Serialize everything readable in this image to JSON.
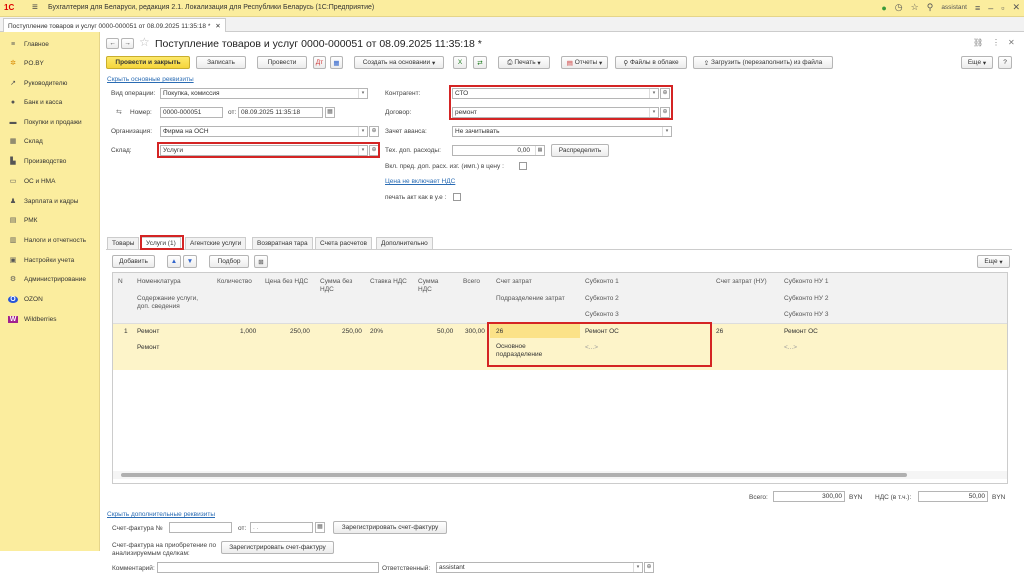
{
  "app": {
    "logo": "1С",
    "title": "Бухгалтерия для Беларуси, редакция 2.1. Локализация для Республики Беларусь (1С:Предприятие)",
    "user": "assistant",
    "tab_title": "Поступление товаров и услуг 0000-000051 от 08.09.2025 11:35:18 *"
  },
  "sidebar": {
    "items": [
      {
        "label": "Главное",
        "icon": "≡"
      },
      {
        "label": "PO.BY",
        "icon": "✲"
      },
      {
        "label": "Руководителю",
        "icon": "↗"
      },
      {
        "label": "Банк и касса",
        "icon": "●"
      },
      {
        "label": "Покупки и продажи",
        "icon": "▬"
      },
      {
        "label": "Склад",
        "icon": "▦"
      },
      {
        "label": "Производство",
        "icon": "▙"
      },
      {
        "label": "ОС и НМА",
        "icon": "▭"
      },
      {
        "label": "Зарплата и кадры",
        "icon": "♟"
      },
      {
        "label": "РМК",
        "icon": "▤"
      },
      {
        "label": "Налоги и отчетность",
        "icon": "▥"
      },
      {
        "label": "Настройки учета",
        "icon": "▣"
      },
      {
        "label": "Администрирование",
        "icon": "⚙"
      },
      {
        "label": "OZON",
        "icon": "O"
      },
      {
        "label": "Wildberries",
        "icon": "W"
      }
    ]
  },
  "doc": {
    "title": "Поступление товаров и услуг 0000-000051 от 08.09.2025 11:35:18 *"
  },
  "toolbar": {
    "post_close": "Провести и закрыть",
    "save": "Записать",
    "post": "Провести",
    "create_based": "Создать на основании",
    "print": "Печать",
    "reports": "Отчеты",
    "files": "Файлы в облаке",
    "load": "Загрузить (перезаполнить) из файла",
    "more": "Еще",
    "help": "?"
  },
  "header": {
    "hide_link": "Скрыть основные реквизиты",
    "op_label": "Вид операции:",
    "op_value": "Покупка, комиссия",
    "num_label": "Номер:",
    "num_value": "0000-000051",
    "from_label": "от:",
    "date_value": "08.09.2025 11:35:18",
    "org_label": "Организация:",
    "org_value": "Фирма на ОСН",
    "wh_label": "Склад:",
    "wh_value": "Услуги",
    "cp_label": "Контрагент:",
    "cp_value": "СТО",
    "contract_label": "Договор:",
    "contract_value": "ремонт",
    "advance_label": "Зачет аванса:",
    "advance_value": "Не зачитывать",
    "extra_label": "Тех. доп. расходы:",
    "extra_value": "0,00",
    "distribute": "Распределить",
    "vkl_label": "Вкл. пред. доп. расх. изг. (имп.) в цену :",
    "vat_link": "Цена не включает НДС",
    "print_act": "печать акт как в у.е :"
  },
  "tabs": [
    "Товары",
    "Услуги (1)",
    "Агентские услуги",
    "Возвратная тара",
    "Счета расчетов",
    "Дополнительно"
  ],
  "table_toolbar": {
    "add": "Добавить",
    "pick": "Подбор",
    "more": "Еще"
  },
  "table": {
    "headers": {
      "n": "N",
      "nomen": "Номенклатура",
      "content": "Содержание услуги, доп. сведения",
      "qty": "Количество",
      "price": "Цена без НДС",
      "sum": "Сумма без НДС",
      "rate": "Ставка НДС",
      "vat": "Сумма НДС",
      "total": "Всего",
      "acc": "Счет затрат",
      "dept": "Подразделение затрат",
      "sub1": "Субконто 1",
      "sub2": "Субконто 2",
      "sub3": "Субконто 3",
      "acc_nu": "Счет затрат (НУ)",
      "snu1": "Субконто НУ 1",
      "snu2": "Субконто НУ 2",
      "snu3": "Субконто НУ 3"
    },
    "row": {
      "n": "1",
      "nomen": "Ремонт",
      "content": "Ремонт",
      "qty": "1,000",
      "price": "250,00",
      "sum": "250,00",
      "rate": "20%",
      "vat": "50,00",
      "total": "300,00",
      "acc": "26",
      "dept": "Основное подразделение",
      "sub1": "Ремонт ОС",
      "sub2": "<...>",
      "acc_nu": "26",
      "snu1": "Ремонт ОС",
      "snu2": "<...>"
    }
  },
  "totals": {
    "total_label": "Всего:",
    "total_value": "300,00",
    "currency": "BYN",
    "vat_label": "НДС (в т.ч.):",
    "vat_value": "50,00",
    "currency2": "BYN"
  },
  "footer": {
    "hide_link": "Скрыть дополнительные реквизиты",
    "invoice_label": "Счет-фактура №",
    "from_label": "от:",
    "invoice_date": ". .",
    "register_btn": "Зарегистрировать счет-фактуру",
    "anal_label": "Счет-фактура на приобретение по анализируемым сделкам:",
    "register_btn2": "Зарегистрировать счет-фактуру",
    "comment_label": "Комментарий:",
    "resp_label": "Ответственный:",
    "resp_value": "assistant"
  }
}
